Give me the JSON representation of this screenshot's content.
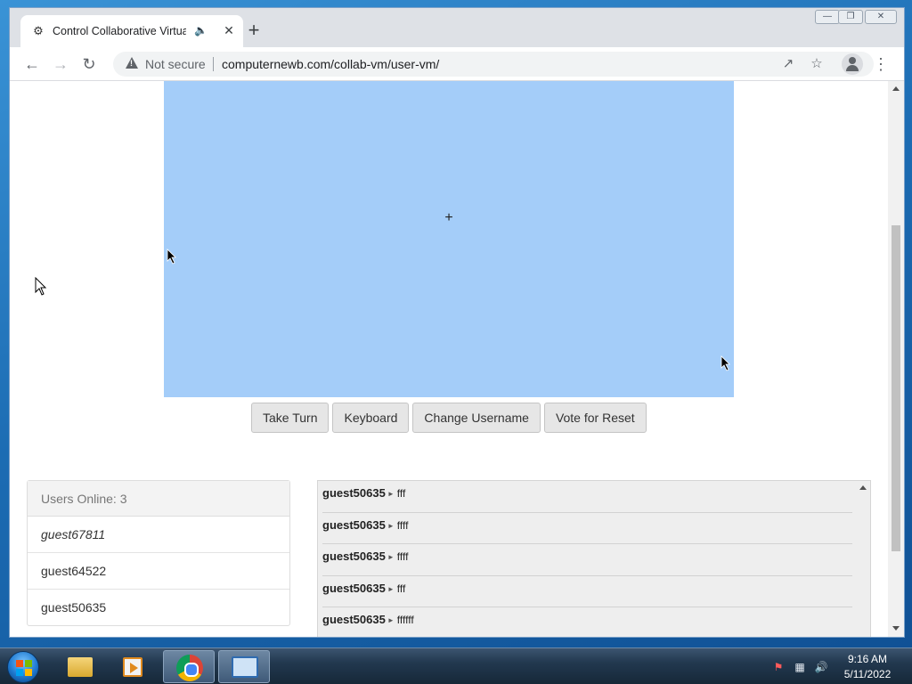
{
  "browser": {
    "tab_title": "Control Collaborative Virtual",
    "security_label": "Not secure",
    "url": "computernewb.com/collab-vm/user-vm/"
  },
  "actions": {
    "take_turn": "Take Turn",
    "keyboard": "Keyboard",
    "change_username": "Change Username",
    "vote_reset": "Vote for Reset"
  },
  "users": {
    "header": "Users Online: 3",
    "list": [
      "guest67811",
      "guest64522",
      "guest50635"
    ]
  },
  "chat": {
    "messages": [
      {
        "user": "guest50635",
        "text": "fff"
      },
      {
        "user": "guest50635",
        "text": "ffff"
      },
      {
        "user": "guest50635",
        "text": "ffff"
      },
      {
        "user": "guest50635",
        "text": "fff"
      },
      {
        "user": "guest50635",
        "text": "ffffff"
      }
    ]
  },
  "taskbar": {
    "time": "9:16 AM",
    "date": "5/11/2022"
  },
  "colors": {
    "vm_screen": "#a4cdf9",
    "button_bg": "#e6e6e6",
    "chat_bg": "#eeeeee"
  }
}
